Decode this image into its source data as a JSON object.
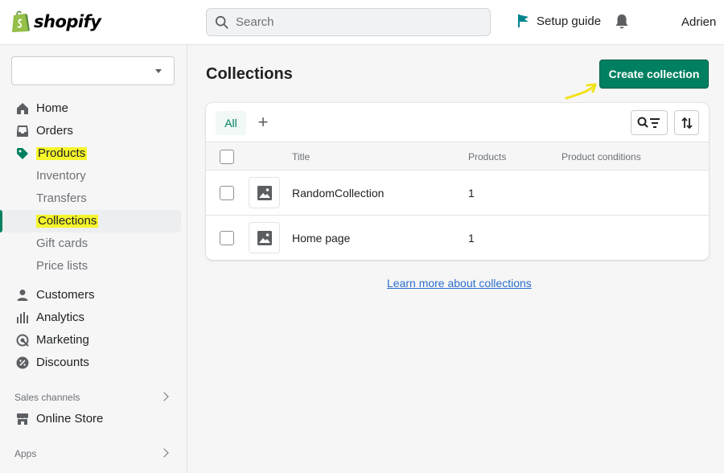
{
  "brand": {
    "name": "shopify",
    "accent": "#008060",
    "highlight": "#f5f52c"
  },
  "topbar": {
    "search_placeholder": "Search",
    "setup_guide": "Setup guide",
    "user_name": "Adrien",
    "icons": {
      "search": "search-icon",
      "setup": "flag-icon",
      "notifications": "bell-icon"
    }
  },
  "sidebar": {
    "store_select_value": "",
    "items": [
      {
        "label": "Home",
        "icon": "home-icon"
      },
      {
        "label": "Orders",
        "icon": "inbox-icon"
      },
      {
        "label": "Products",
        "icon": "tag-icon"
      },
      {
        "label": "Inventory"
      },
      {
        "label": "Transfers"
      },
      {
        "label": "Collections"
      },
      {
        "label": "Gift cards"
      },
      {
        "label": "Price lists"
      },
      {
        "label": "Customers",
        "icon": "person-icon"
      },
      {
        "label": "Analytics",
        "icon": "bar-chart-icon"
      },
      {
        "label": "Marketing",
        "icon": "target-icon"
      },
      {
        "label": "Discounts",
        "icon": "discount-icon"
      }
    ],
    "sales_channels_label": "Sales channels",
    "online_store": "Online Store",
    "apps_label": "Apps"
  },
  "main": {
    "title": "Collections",
    "create_button": "Create collection",
    "tabs": {
      "all": "All",
      "add": "+"
    },
    "columns": {
      "title": "Title",
      "products": "Products",
      "conditions": "Product conditions"
    },
    "rows": [
      {
        "title": "RandomCollection",
        "products": "1",
        "conditions": ""
      },
      {
        "title": "Home page",
        "products": "1",
        "conditions": ""
      }
    ],
    "learn_more": "Learn more about collections"
  }
}
